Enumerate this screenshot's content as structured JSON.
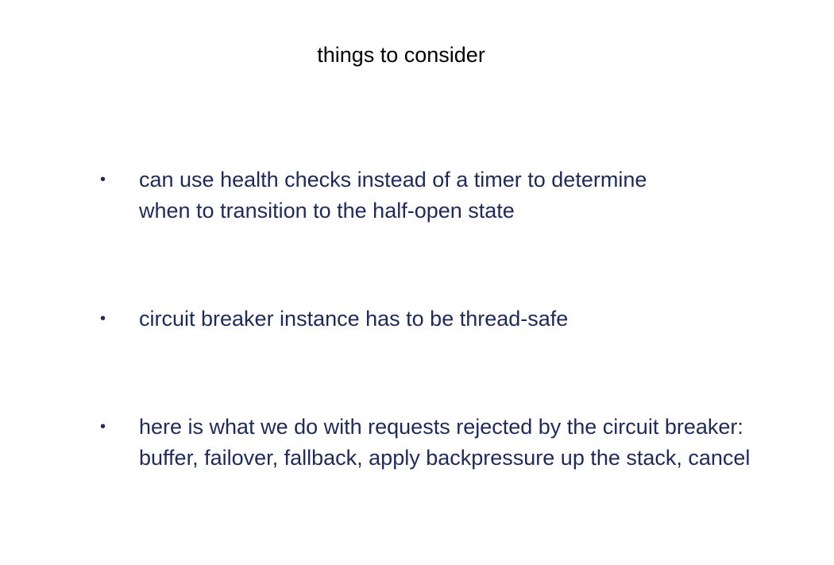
{
  "slide": {
    "title": "things to consider",
    "bullets": [
      {
        "lines": [
          "can use health checks instead of a timer to determine",
          "when to transition to the half-open state"
        ]
      },
      {
        "lines": [
          "circuit breaker instance has to be thread-safe"
        ]
      },
      {
        "lines": [
          "here is what we do with requests rejected by the circuit breaker:",
          "buffer, failover, fallback, apply backpressure up the stack, cancel"
        ]
      }
    ],
    "bullet_symbol": "•",
    "colors": {
      "title": "#000000",
      "body": "#1f2a5a",
      "background": "#ffffff"
    }
  }
}
